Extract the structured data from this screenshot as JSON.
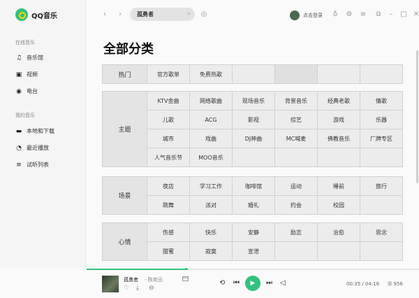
{
  "app": {
    "name": "QQ音乐"
  },
  "sidebar": {
    "sections": [
      {
        "title": "在线音乐",
        "items": [
          "音乐馆",
          "视频",
          "电台"
        ]
      },
      {
        "title": "我的音乐",
        "items": [
          "本地和下载",
          "最近播放",
          "试听列表"
        ]
      }
    ]
  },
  "topbar": {
    "search_value": "孤勇者",
    "login_label": "点击登录"
  },
  "page": {
    "title": "全部分类"
  },
  "categories": [
    {
      "group": "热门",
      "items": [
        "官方歌单",
        "免费热歌",
        "",
        "",
        "",
        ""
      ]
    },
    {
      "group": "主题",
      "items": [
        "KTV金曲",
        "网络歌曲",
        "现场音乐",
        "背景音乐",
        "经典老歌",
        "情歌",
        "儿歌",
        "ACG",
        "影视",
        "综艺",
        "游戏",
        "乐器",
        "城市",
        "戏曲",
        "DJ神曲",
        "MC喊麦",
        "佛教音乐",
        "厂牌专区",
        "人气音乐节",
        "MOO音乐",
        "",
        "",
        "",
        ""
      ]
    },
    {
      "group": "场景",
      "items": [
        "夜店",
        "学习工作",
        "咖啡馆",
        "运动",
        "睡前",
        "旅行",
        "跳舞",
        "派对",
        "婚礼",
        "约会",
        "校园",
        ""
      ]
    },
    {
      "group": "心情",
      "items": [
        "伤感",
        "快乐",
        "安静",
        "励志",
        "治愈",
        "思念",
        "甜蜜",
        "寂寞",
        "宣泄",
        "",
        "",
        ""
      ]
    }
  ],
  "player": {
    "song": "孤勇者",
    "separator": "-",
    "singer": "陈奕迅",
    "mv_label": "MV",
    "time": "00:35 / 04:16",
    "quality": "956",
    "progress": 0.3
  },
  "colors": {
    "accent": "#31c27c"
  }
}
